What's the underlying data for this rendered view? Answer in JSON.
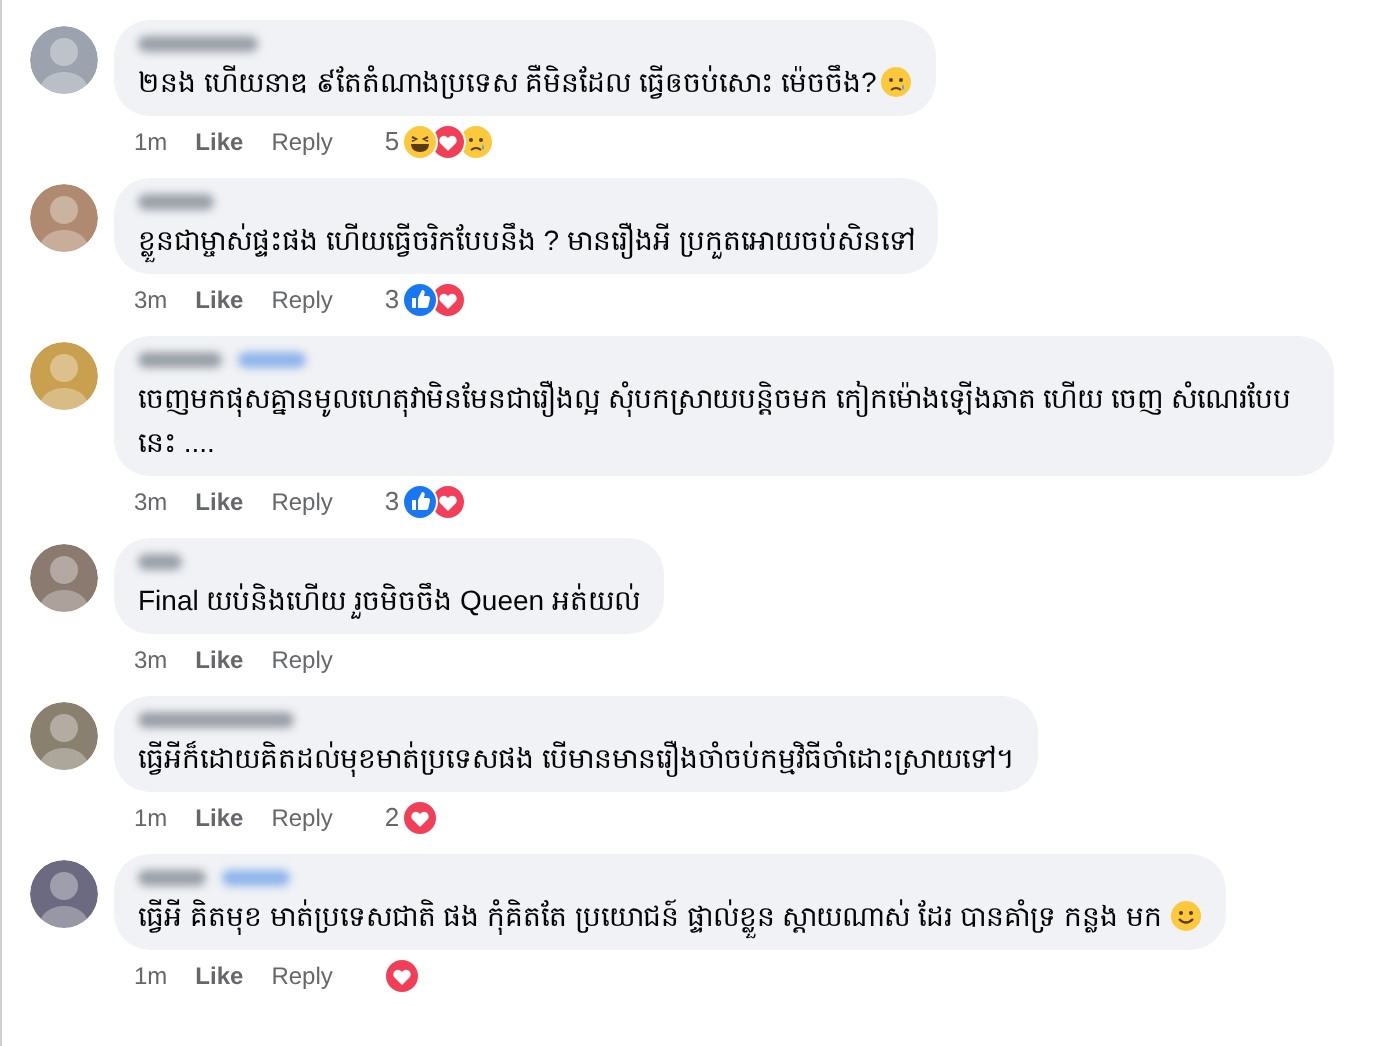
{
  "comments": [
    {
      "follow": false,
      "text": "២នង ហើយនាឌ ៩តែតំណាងប្រទេស គឺមិនដែល ធ្វើឲចប់សោះ ម៉េចចឹង?",
      "emoji": {
        "kind": "sad"
      },
      "time": "1m",
      "like": "Like",
      "reply": "Reply",
      "reaction_count": "5",
      "reactions": [
        {
          "kind": "haha"
        },
        {
          "kind": "love"
        },
        {
          "kind": "sad"
        }
      ]
    },
    {
      "follow": false,
      "text": "ខ្លួនជាម្ចាស់ផ្ទះផង ហើយធ្វើចរិកបែបនឹង ? មានរឿងអី ប្រកួតអោយចប់សិនទៅ",
      "time": "3m",
      "like": "Like",
      "reply": "Reply",
      "reaction_count": "3",
      "reactions": [
        {
          "kind": "like"
        },
        {
          "kind": "love"
        }
      ]
    },
    {
      "follow": true,
      "text": "ចេញមកផុសគ្នានមូលហេតុវាមិនមែនជារឿងល្អ សុំបកស្រាយបន្តិចមក កៀកម៉ោងឡើងឆាត ហើយ ចេញ សំណេរបែបនេះ ....",
      "time": "3m",
      "like": "Like",
      "reply": "Reply",
      "reaction_count": "3",
      "reactions": [
        {
          "kind": "like"
        },
        {
          "kind": "love"
        }
      ]
    },
    {
      "follow": false,
      "text": "Final យប់និងហើយ រួចមិចចឹង Queen អត់យល់",
      "time": "3m",
      "like": "Like",
      "reply": "Reply"
    },
    {
      "follow": false,
      "text": "ធ្វើអីក៏ដោយគិតដល់មុខមាត់ប្រទេសផង បើមានមានរឿងចាំចប់កម្មវិធីចាំដោះស្រាយទៅ។",
      "time": "1m",
      "like": "Like",
      "reply": "Reply",
      "reaction_count": "2",
      "reactions": [
        {
          "kind": "love"
        }
      ]
    },
    {
      "follow": true,
      "text": "ធ្វើអី គិតមុខ មាត់ប្រទេសជាតិ ផង កុំគិតតែ ប្រយោជន៍ ផ្ទាល់ខ្លួន ស្តាយណាស់ ដែរ បានគាំទ្រ កន្លង មក",
      "emoji": {
        "kind": "smile"
      },
      "time": "1m",
      "like": "Like",
      "reply": "Reply",
      "reactions": [
        {
          "kind": "love"
        }
      ]
    }
  ]
}
